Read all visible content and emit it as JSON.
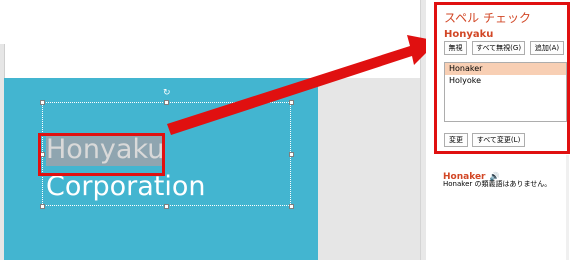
{
  "slide": {
    "title_line1": "Honyaku",
    "title_line2": "Corporation"
  },
  "spell_pane": {
    "title": "スペル チェック",
    "misspelled_word": "Honyaku",
    "ignore_label": "無視",
    "ignore_all_label": "すべて無視(G)",
    "add_label": "追加(A)",
    "suggestions": [
      "Honaker",
      "Holyoke"
    ],
    "selected_suggestion_index": 0,
    "change_label": "変更",
    "change_all_label": "すべて変更(L)",
    "preview_word": "Honaker",
    "preview_note": "Honaker の類義語はありません。"
  },
  "colors": {
    "slide_teal": "#43b5d0",
    "annotation_red": "#e01010",
    "pane_accent": "#d24726",
    "selected_suggestion": "#f8cfb4"
  },
  "icons": {
    "rotate": "rotate-handle-icon",
    "speaker": "speaker-icon",
    "arrow": "red-arrow-icon"
  }
}
